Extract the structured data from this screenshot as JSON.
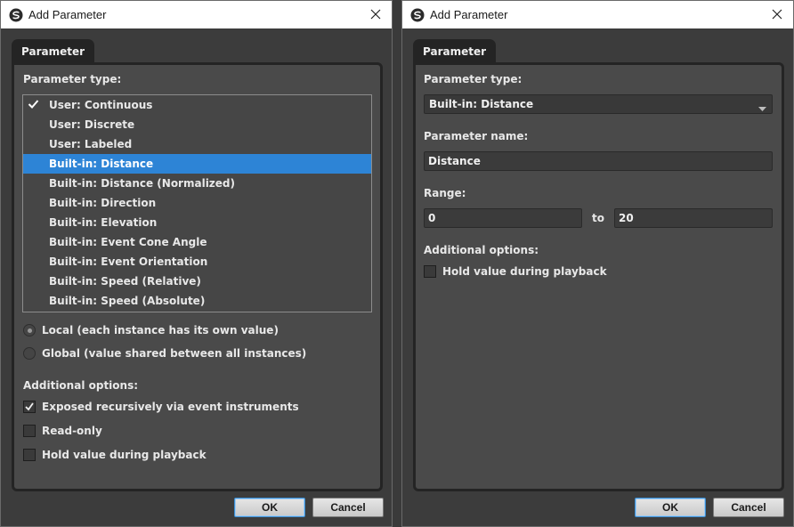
{
  "left_dialog": {
    "title": "Add Parameter",
    "tab": "Parameter",
    "parameter_type_label": "Parameter type:",
    "dropdown_items": [
      {
        "label": "User: Continuous",
        "checked": true,
        "selected": false
      },
      {
        "label": "User: Discrete",
        "checked": false,
        "selected": false
      },
      {
        "label": "User: Labeled",
        "checked": false,
        "selected": false
      },
      {
        "label": "Built-in: Distance",
        "checked": false,
        "selected": true
      },
      {
        "label": "Built-in: Distance (Normalized)",
        "checked": false,
        "selected": false
      },
      {
        "label": "Built-in: Direction",
        "checked": false,
        "selected": false
      },
      {
        "label": "Built-in: Elevation",
        "checked": false,
        "selected": false
      },
      {
        "label": "Built-in: Event Cone Angle",
        "checked": false,
        "selected": false
      },
      {
        "label": "Built-in: Event Orientation",
        "checked": false,
        "selected": false
      },
      {
        "label": "Built-in: Speed (Relative)",
        "checked": false,
        "selected": false
      },
      {
        "label": "Built-in: Speed (Absolute)",
        "checked": false,
        "selected": false
      }
    ],
    "scope_options": [
      {
        "label": "Local (each instance has its own value)",
        "checked": true
      },
      {
        "label": "Global (value shared between all instances)",
        "checked": false
      }
    ],
    "additional_options_label": "Additional options:",
    "checkboxes": [
      {
        "label": "Exposed recursively via event instruments",
        "checked": true
      },
      {
        "label": "Read-only",
        "checked": false
      },
      {
        "label": "Hold value during playback",
        "checked": false
      }
    ],
    "ok_label": "OK",
    "cancel_label": "Cancel"
  },
  "right_dialog": {
    "title": "Add Parameter",
    "tab": "Parameter",
    "parameter_type_label": "Parameter type:",
    "parameter_type_value": "Built-in: Distance",
    "parameter_name_label": "Parameter name:",
    "parameter_name_value": "Distance",
    "range_label": "Range:",
    "range_min": "0",
    "range_to": "to",
    "range_max": "20",
    "additional_options_label": "Additional options:",
    "checkboxes": [
      {
        "label": "Hold value during playback",
        "checked": false
      }
    ],
    "ok_label": "OK",
    "cancel_label": "Cancel"
  },
  "colors": {
    "accent": "#2d84d6",
    "panel_bg": "#4a4a4a",
    "panel_border": "#242424"
  }
}
